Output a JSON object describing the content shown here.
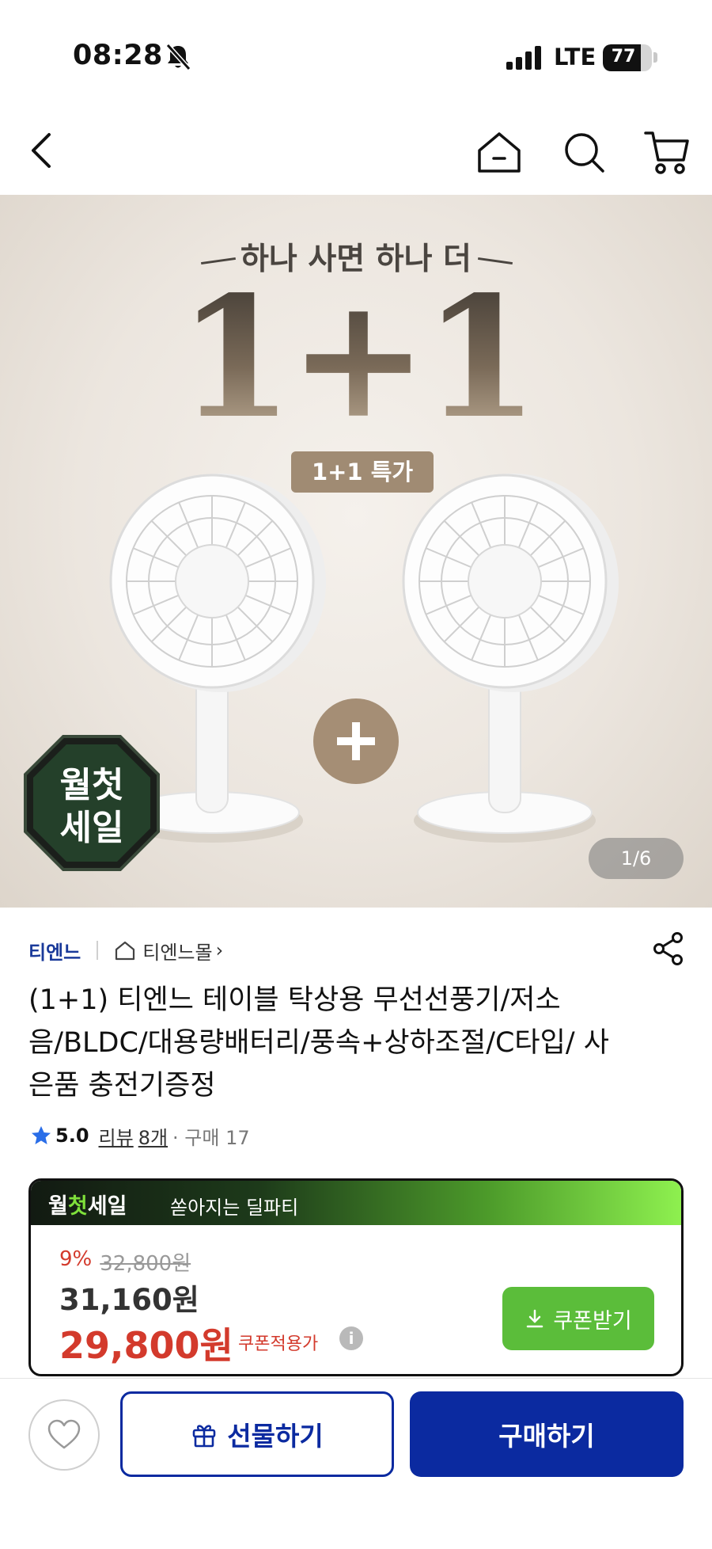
{
  "status_bar": {
    "time": "08:28",
    "network": "LTE",
    "battery": "77",
    "battery_level": 0.77
  },
  "icons": {
    "back": "chevron-left-icon",
    "home": "home-icon",
    "search": "search-icon",
    "cart": "cart-icon",
    "share": "share-icon",
    "wish": "heart-icon",
    "gift": "gift-icon",
    "download": "download-icon"
  },
  "hero": {
    "subtitle": "하나 사면 하나 더",
    "headline": "1+1",
    "tag": "1+1 특가",
    "badge_line1": "월첫",
    "badge_line2": "세일",
    "page_indicator": "1/6"
  },
  "product": {
    "brand": "티엔느",
    "store": "티엔느몰",
    "store_chevron": "›",
    "title": "(1+1) 티엔느 테이블 탁상용 무선선풍기/저소음/BLDC/대용량배터리/풍속+상하조절/C타입/ 사은품 충전기증정",
    "rating": "5.0",
    "review_label": "리뷰",
    "review_count": "8개",
    "purchase_label": "· 구매 17"
  },
  "price": {
    "promo_logo_a": "월",
    "promo_logo_b": "첫",
    "promo_logo_c": "세일",
    "promo_text": "쏟아지는 딜파티",
    "discount_rate": "9%",
    "original_price": "32,800원",
    "sale_price": "31,160원",
    "coupon_price": "29,800원",
    "coupon_label": "쿠폰적용가",
    "info_icon": "i",
    "coupon_button": "쿠폰받기"
  },
  "bottom_bar": {
    "gift_button": "선물하기",
    "buy_button": "구매하기"
  },
  "colors": {
    "primary_blue": "#0b2aa0",
    "sale_red": "#d33a2c",
    "coupon_green": "#5bbd3a",
    "promo_green": "#8ef04f"
  }
}
